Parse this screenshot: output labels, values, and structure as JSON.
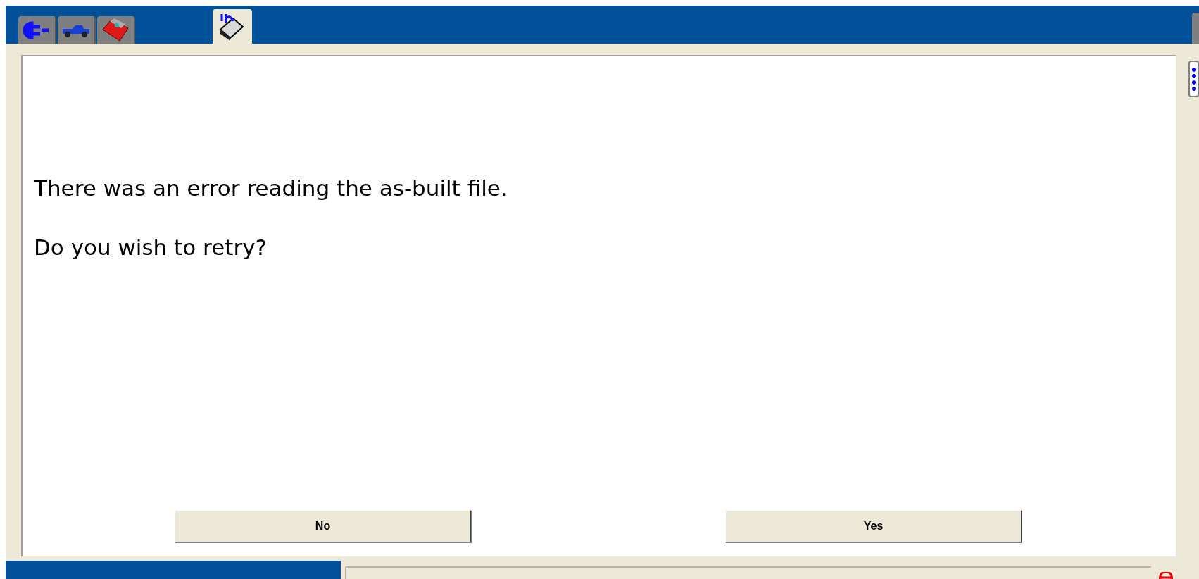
{
  "tabs": [
    {
      "kind": "connect",
      "selected": false
    },
    {
      "kind": "vehicle",
      "selected": false
    },
    {
      "kind": "toolbox",
      "selected": false
    },
    {
      "kind": "info",
      "selected": true
    }
  ],
  "message": {
    "lines": [
      "There was an error reading the as-built file.",
      "Do you wish to retry?"
    ]
  },
  "buttons": [
    "No",
    "Yes"
  ]
}
